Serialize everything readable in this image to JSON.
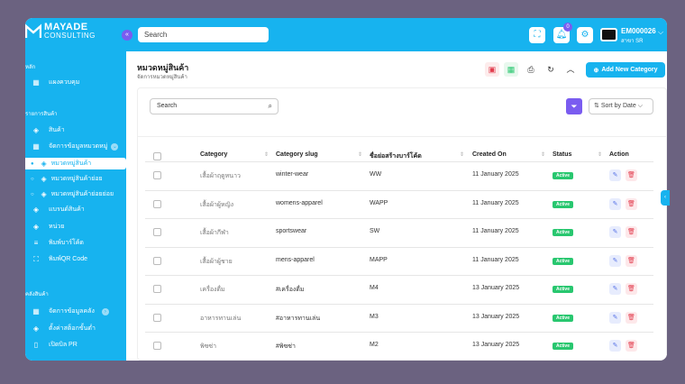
{
  "topbar": {
    "logo_line1": "MAYADE",
    "logo_line2": "CONSULTING",
    "search_placeholder": "Search",
    "notification_count": "0",
    "user_name": "EM000026",
    "user_branch": "สาขา SR"
  },
  "sidebar": {
    "sections": [
      {
        "heading": "หลัก",
        "items": [
          {
            "label": "แผงควบคุม",
            "icon": "grid-icon"
          }
        ]
      },
      {
        "heading": "รายการสินค้า",
        "items": [
          {
            "label": "สินค้า",
            "icon": "box-icon"
          },
          {
            "label": "จัดการข้อมูลหมวดหมู่",
            "icon": "grid-icon"
          },
          {
            "label": "หมวดหมู่สินค้า",
            "icon": "box-icon",
            "active": true
          },
          {
            "label": "หมวดหมู่สินค้าย่อย",
            "icon": "box-icon"
          },
          {
            "label": "หมวดหมู่สินค้าย่อยย่อย",
            "icon": "box-icon"
          },
          {
            "label": "แบรนด์สินค้า",
            "icon": "box-icon"
          },
          {
            "label": "หน่วย",
            "icon": "box-icon"
          },
          {
            "label": "พิมพ์บาร์โค้ด",
            "icon": "barcode-icon"
          },
          {
            "label": "พิมพ์QR Code",
            "icon": "qr-icon"
          }
        ]
      },
      {
        "heading": "คลังสินค้า",
        "items": [
          {
            "label": "จัดการข้อมูลคลัง",
            "icon": "grid-icon"
          },
          {
            "label": "ตั้งค่าสต็อกขั้นต่ำ",
            "icon": "box-icon"
          },
          {
            "label": "เปิดบิล PR",
            "icon": "file-icon"
          }
        ]
      }
    ]
  },
  "page": {
    "title": "หมวดหมู่สินค้า",
    "subtitle": "จัดการหมวดหมู่สินค้า",
    "add_button": "Add New Category"
  },
  "toolbar": {
    "search_placeholder": "Search",
    "sort_label": "Sort by Date"
  },
  "table": {
    "headers": [
      "Category",
      "Category slug",
      "ชื่อย่อสร้างบาร์โค้ด",
      "Created On",
      "Status",
      "Action"
    ],
    "rows": [
      {
        "category": "เสื้อผ้าฤดูหนาว",
        "slug": "winter-wear",
        "code": "WW",
        "created": "11 January 2025",
        "status": "Active"
      },
      {
        "category": "เสื้อผ้าผู้หญิง",
        "slug": "womens-apparel",
        "code": "WAPP",
        "created": "11 January 2025",
        "status": "Active"
      },
      {
        "category": "เสื้อผ้ากีฬา",
        "slug": "sportswear",
        "code": "SW",
        "created": "11 January 2025",
        "status": "Active"
      },
      {
        "category": "เสื้อผ้าผู้ชาย",
        "slug": "mens-apparel",
        "code": "MAPP",
        "created": "11 January 2025",
        "status": "Active"
      },
      {
        "category": "เครื่องดื่ม",
        "slug": "#เครื่องดื่ม",
        "code": "M4",
        "created": "13 January 2025",
        "status": "Active"
      },
      {
        "category": "อาหารทานเล่น",
        "slug": "#อาหารทานเล่น",
        "code": "M3",
        "created": "13 January 2025",
        "status": "Active"
      },
      {
        "category": "พิซซ่า",
        "slug": "#พิซซ่า",
        "code": "M2",
        "created": "13 January 2025",
        "status": "Active"
      }
    ]
  },
  "colors": {
    "brand": "#17b3ef",
    "accent": "#7a5cf0",
    "active": "#28c76f",
    "danger": "#e23c4d"
  }
}
